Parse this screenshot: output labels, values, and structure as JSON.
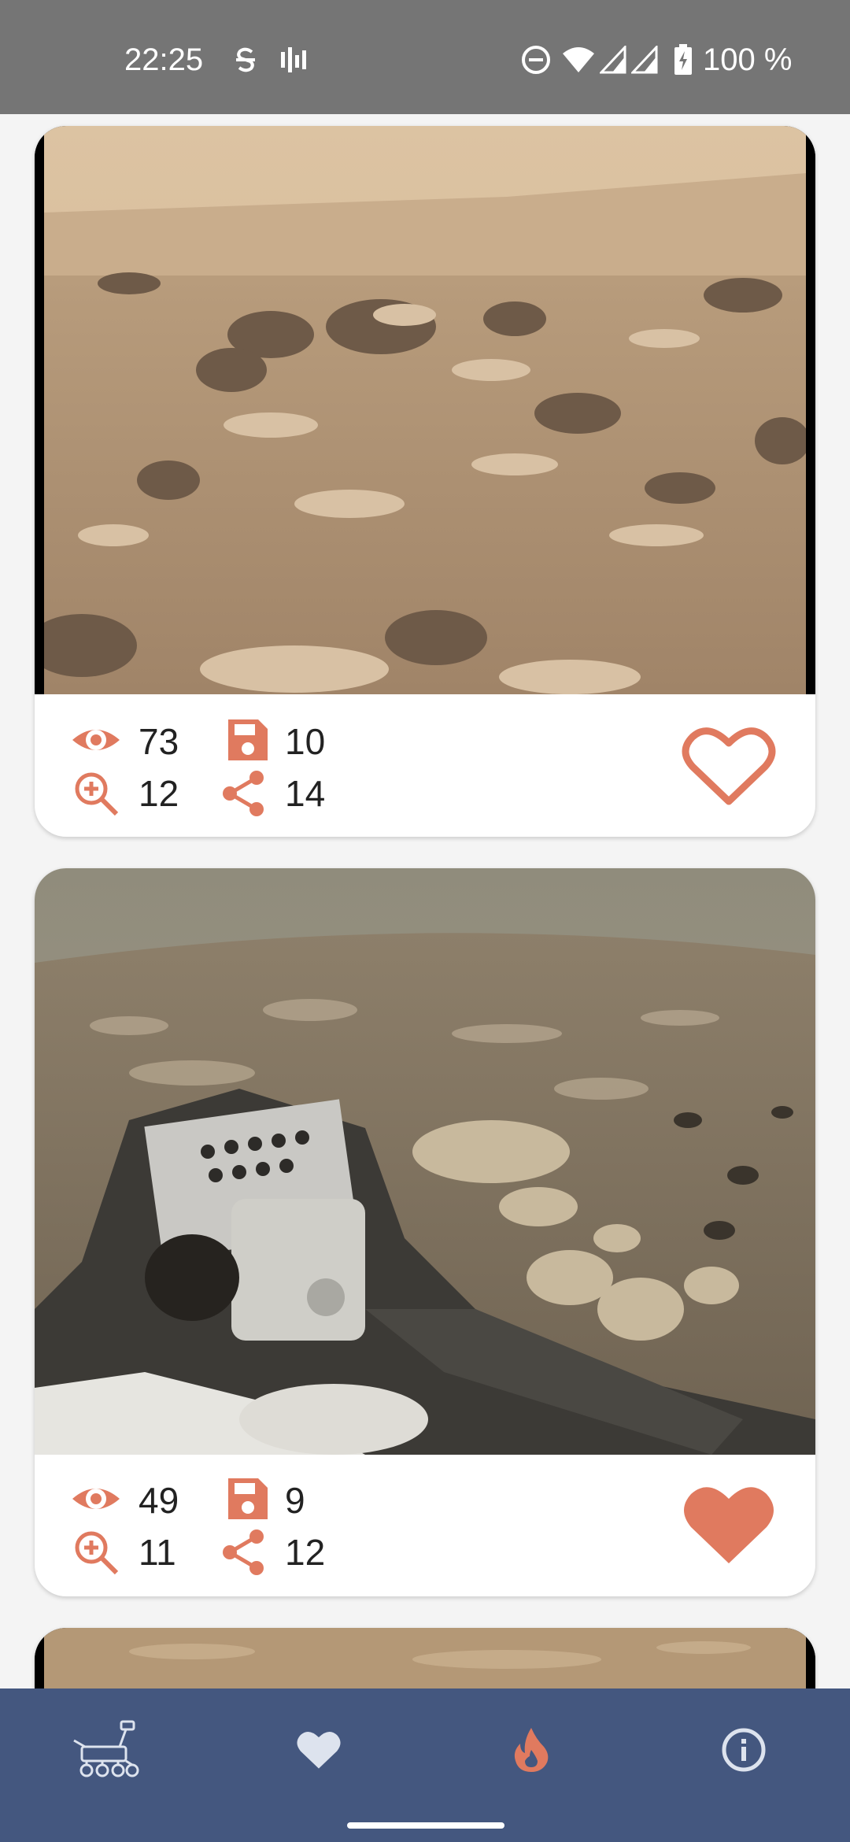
{
  "status_bar": {
    "time": "22:25",
    "battery_text": "100 %",
    "icons": [
      "s-notification-icon",
      "signal-bars-icon",
      "dnd-icon",
      "wifi-icon",
      "cell-signal-icon",
      "cell-signal-icon",
      "battery-charging-icon"
    ]
  },
  "colors": {
    "accent": "#e07a5f",
    "nav_background": "#44577f",
    "status_bar": "#757575"
  },
  "posts": [
    {
      "views": "73",
      "saves": "10",
      "zooms": "12",
      "shares": "14",
      "liked": false
    },
    {
      "views": "49",
      "saves": "9",
      "zooms": "11",
      "shares": "12",
      "liked": true
    }
  ],
  "bottom_nav": {
    "items": [
      {
        "icon": "rover-icon",
        "active": false
      },
      {
        "icon": "heart-icon",
        "active": false
      },
      {
        "icon": "fire-icon",
        "active": true
      },
      {
        "icon": "info-icon",
        "active": false
      }
    ]
  }
}
